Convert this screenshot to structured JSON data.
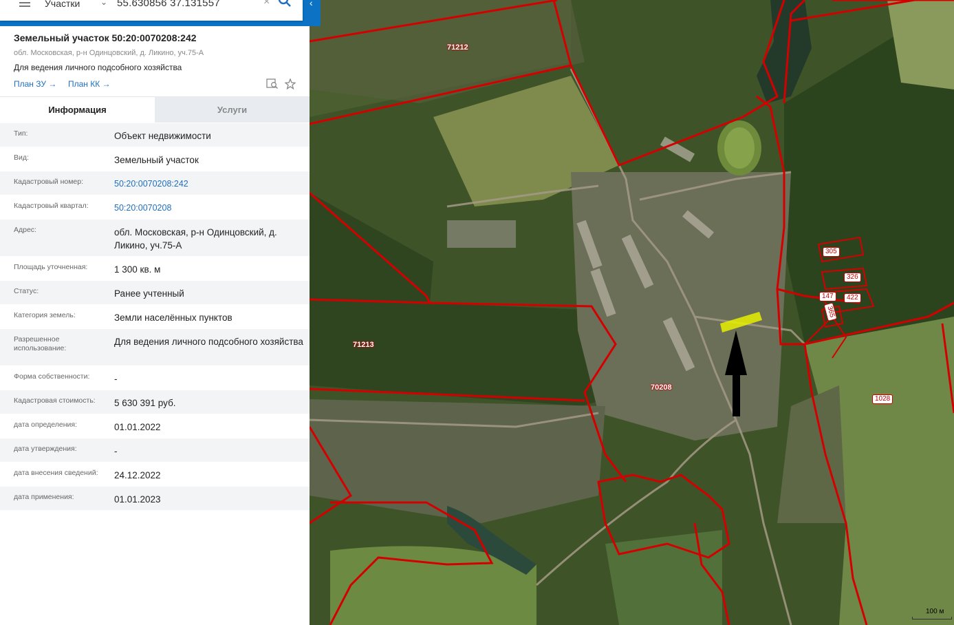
{
  "search": {
    "type": "Участки",
    "query": "55.630856 37.131557"
  },
  "object": {
    "title": "Земельный участок 50:20:0070208:242",
    "address": "обл. Московская, р-н Одинцовский, д. Ликино, уч.75-А",
    "purpose": "Для ведения личного подсобного хозяйства",
    "link_plan_zu": "План ЗУ →",
    "link_plan_kk": "План КК →"
  },
  "tabs": {
    "info": "Информация",
    "services": "Услуги"
  },
  "details": [
    {
      "label": "Тип:",
      "value": "Объект недвижимости"
    },
    {
      "label": "Вид:",
      "value": "Земельный участок"
    },
    {
      "label": "Кадастровый номер:",
      "value": "50:20:0070208:242"
    },
    {
      "label": "Кадастровый квартал:",
      "value": "50:20:0070208"
    },
    {
      "label": "Адрес:",
      "value": "обл. Московская, р-н Одинцовский, д. Ликино, уч.75-А"
    },
    {
      "label": "Площадь уточненная:",
      "value": "1 300 кв. м"
    },
    {
      "label": "Статус:",
      "value": "Ранее учтенный"
    },
    {
      "label": "Категория земель:",
      "value": "Земли населённых пунктов"
    },
    {
      "label": "Разрешенное использование:",
      "value": "Для ведения личного подсобного хозяйства"
    },
    {
      "label": "Форма собственности:",
      "value": "-"
    },
    {
      "label": "Кадастровая стоимость:",
      "value": "5 630 391 руб."
    },
    {
      "label": "дата определения:",
      "value": "01.01.2022"
    },
    {
      "label": "дата утверждения:",
      "value": "-"
    },
    {
      "label": "дата внесения сведений:",
      "value": "24.12.2022"
    },
    {
      "label": "дата применения:",
      "value": "01.01.2023"
    }
  ],
  "map": {
    "quarters": [
      "71212",
      "71213",
      "70208"
    ],
    "parcels": [
      "305",
      "326",
      "147",
      "422",
      "365",
      "1028"
    ],
    "scale": "100 м",
    "colors": {
      "boundary": "#d40000",
      "highlight": "#e8f000",
      "arrow": "#000000"
    }
  }
}
